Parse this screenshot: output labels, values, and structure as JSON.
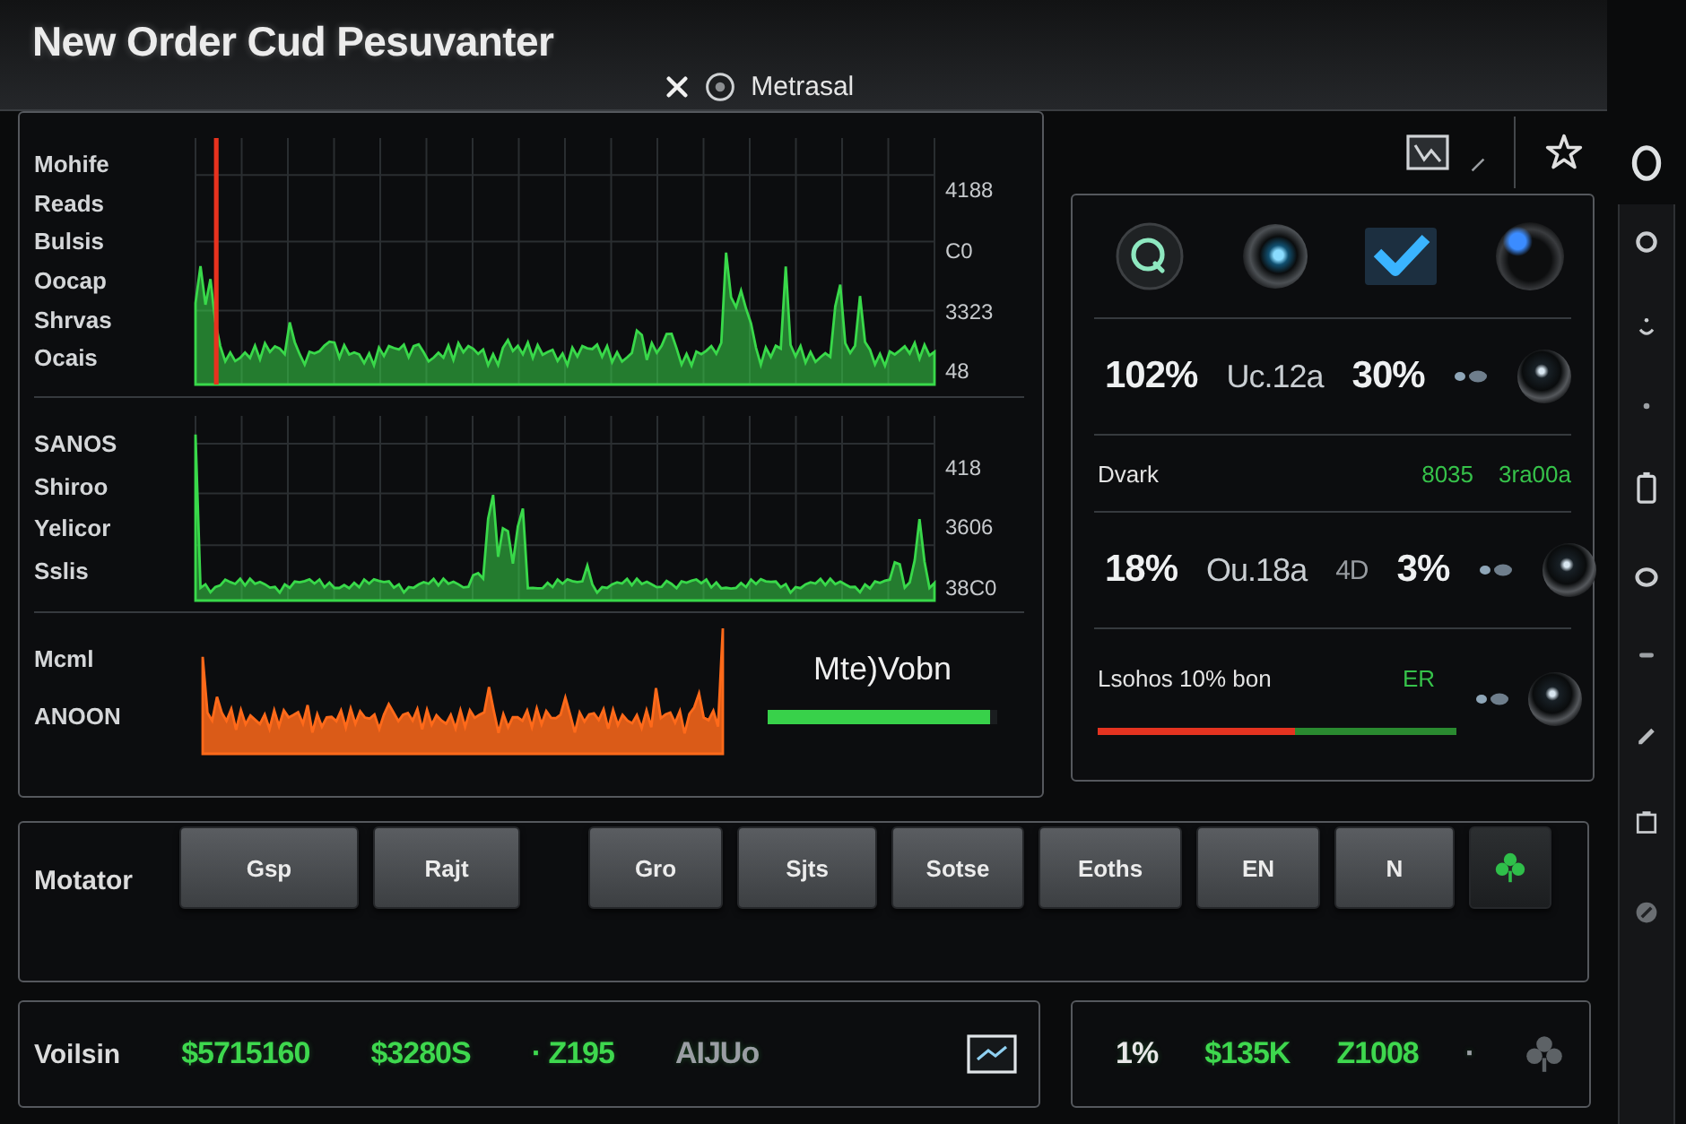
{
  "window": {
    "title": "New Order Cud Pesuvanter",
    "tab_label": "Metrasal"
  },
  "signal_panel": {
    "rows": [
      {
        "kind": "waveform",
        "color": "#39d94a",
        "labels": [
          "Mohife",
          "Reads",
          "Bulsis",
          "Oocap",
          "Shrvas",
          "Ocais"
        ],
        "scale": [
          "4188",
          "C0",
          "3323",
          "48"
        ]
      },
      {
        "kind": "waveform",
        "color": "#39d94a",
        "labels": [
          "SANOS",
          "Shiroo",
          "Yelicor",
          "Sslis"
        ],
        "scale": [
          "418",
          "3606",
          "38C0"
        ]
      },
      {
        "kind": "spectrum",
        "color": "#ff6a1a",
        "labels": [
          "Mcml",
          "ANOON"
        ],
        "readout": "Mte)Vobn",
        "level": 0.97
      }
    ]
  },
  "stats_panel": {
    "rows": [
      {
        "kind": "readings",
        "values": [
          "102%",
          "Uc.12a",
          "30%"
        ]
      },
      {
        "kind": "caption",
        "label": "Dvark",
        "values": [
          "8035",
          "3ra00a"
        ]
      },
      {
        "kind": "readings",
        "values": [
          "18%",
          "Ou.18a",
          "4D",
          "3%"
        ]
      },
      {
        "kind": "meter",
        "label": "Lsohos 10% bon",
        "values": [
          "ER"
        ],
        "level": 0.55
      }
    ]
  },
  "motor_bar": {
    "label": "Motator",
    "buttons": [
      "Gsp",
      "Rajt",
      "Gro",
      "Sjts",
      "Sotse",
      "Eoths",
      "EN",
      "N"
    ]
  },
  "totals": {
    "label": "Voilsin",
    "values": [
      {
        "text": "$5715160",
        "color": "#3ed84e"
      },
      {
        "text": "$3280S",
        "color": "#3ed84e"
      },
      {
        "text": "· Z195",
        "color": "#3ed84e"
      },
      {
        "text": "AIJUo",
        "color": "#9a9ea4"
      }
    ]
  },
  "summary": {
    "values": [
      {
        "text": "1%",
        "color": "#e8e8e8"
      },
      {
        "text": "$135K",
        "color": "#3ed84e"
      },
      {
        "text": "Z1008",
        "color": "#3ed84e"
      },
      {
        "text": "·",
        "color": "#9a9ea4"
      }
    ]
  }
}
